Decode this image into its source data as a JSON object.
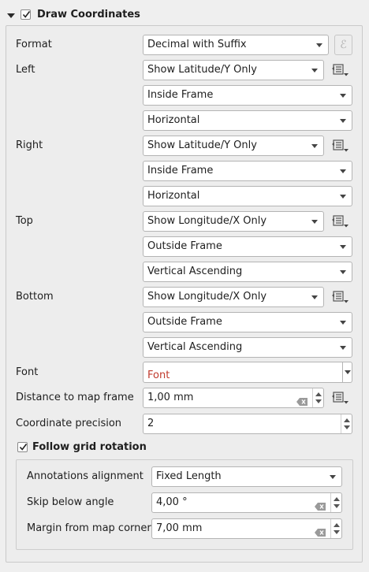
{
  "header": {
    "title": "Draw Coordinates",
    "checked": true
  },
  "format": {
    "label": "Format",
    "value": "Decimal with Suffix",
    "expression_button": "ℰ"
  },
  "sides": [
    {
      "label": "Left",
      "display": "Show Latitude/Y Only",
      "position": "Inside Frame",
      "direction": "Horizontal"
    },
    {
      "label": "Right",
      "display": "Show Latitude/Y Only",
      "position": "Inside Frame",
      "direction": "Horizontal"
    },
    {
      "label": "Top",
      "display": "Show Longitude/X Only",
      "position": "Outside Frame",
      "direction": "Vertical Ascending"
    },
    {
      "label": "Bottom",
      "display": "Show Longitude/X Only",
      "position": "Outside Frame",
      "direction": "Vertical Ascending"
    }
  ],
  "font": {
    "label": "Font",
    "value": "Font",
    "color": "#c0392b"
  },
  "distance": {
    "label": "Distance to map frame",
    "value": "1,00 mm"
  },
  "precision": {
    "label": "Coordinate precision",
    "value": "2"
  },
  "follow": {
    "label": "Follow grid rotation",
    "checked": true,
    "alignment": {
      "label": "Annotations alignment",
      "value": "Fixed Length"
    },
    "skip": {
      "label": "Skip below angle",
      "value": "4,00 °"
    },
    "margin": {
      "label": "Margin from map corner",
      "value": "7,00 mm"
    }
  }
}
